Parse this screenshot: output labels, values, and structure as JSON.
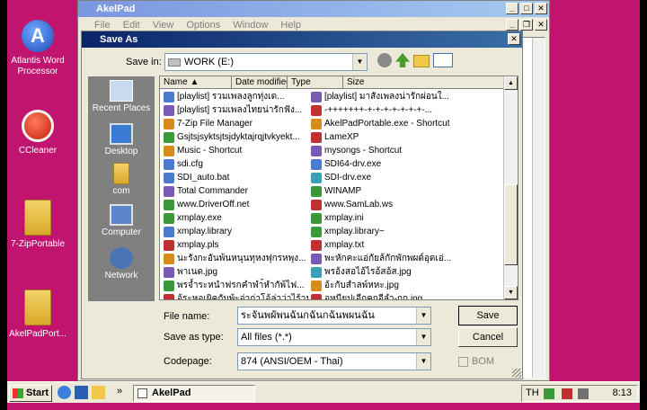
{
  "desktop": {
    "icons": [
      {
        "label": "Atlantis Word Processor",
        "icon": "atlantis-icon"
      },
      {
        "label": "CCleaner",
        "icon": "ccleaner-icon"
      },
      {
        "label": "7-ZipPortable",
        "icon": "folder-icon"
      },
      {
        "label": "AkelPadPort...",
        "icon": "folder-icon"
      }
    ]
  },
  "akelpad": {
    "title": "AkelPad",
    "menu": [
      "File",
      "Edit",
      "View",
      "Options",
      "Window",
      "Help"
    ]
  },
  "dialog": {
    "title": "Save As",
    "save_in_label": "Save in:",
    "save_in_value": "WORK (E:)",
    "places": [
      "Recent Places",
      "Desktop",
      "com",
      "Computer",
      "Network"
    ],
    "columns": [
      "Name",
      "Date modified",
      "Type",
      "Size"
    ],
    "files_col1": [
      "[playlist] รวมเพลงลูกทุ่งเด...",
      "[playlist] รวมเพลงไทยน่ารักฟัง...",
      "7-Zip File Manager",
      "Gsjtsjsyktsjtsjdyktajrqjtvkyekt...",
      "Music - Shortcut",
      "sdi.cfg",
      "SDI_auto.bat",
      "Total Commander",
      "www.DriverOff.net",
      "xmplay.exe",
      "xmplay.library",
      "xmplay.pls",
      "นะรังกะอันพ้นหนุนทุหงฟุกรหพุง...",
      "พาเนด.jpg",
      "พรจ้ำระหนำฟรกคำพำ้หำกัพ้ไฟ...",
      "อุ้ระหอเผิคกับพ้ะอ่าก่าโอ้ล่าว่าไร้านกั..."
    ],
    "files_col2": [
      "[playlist] มาสังเพลงน่ารักผ่อนใ...",
      "-+++++++-+-+-+-+-+-+-+-...",
      "AkelPadPortable.exe - Shortcut",
      "LameXP",
      "mysongs - Shortcut",
      "SDI64-drv.exe",
      "SDI-drv.exe",
      "WINAMP",
      "www.SamLab.ws",
      "xmplay.ini",
      "xmplay.library~",
      "xmplay.txt",
      "พะหักคะแอ่กัยล้กักพักพผด์อุดเอ่...",
      "พรอ้งสอไอ้ไรอ้สอ้ส.jpg",
      "อ้ะกับสำลพ์หหะ.jpg",
      "อุหนียปเอีกคกอีลำ-กก.jpg"
    ],
    "file_name_label": "File name:",
    "file_name_value": "ระจันพผัพนฉันกฉันกฉันพผนฉัน",
    "save_as_type_label": "Save as type:",
    "save_as_type_value": "All files (*.*)",
    "codepage_label": "Codepage:",
    "codepage_value": "874  (ANSI/OEM - Thai)",
    "save_button": "Save",
    "cancel_button": "Cancel",
    "bom_label": "BOM"
  },
  "taskbar": {
    "start": "Start",
    "chevron": "»",
    "task": "AkelPad",
    "lang": "TH",
    "clock": "8:13"
  },
  "colors": {
    "desktop": "#c0146e",
    "title_active": "#0a246a",
    "dialog_bg": "#ece9d8",
    "places_bg": "#808080"
  }
}
